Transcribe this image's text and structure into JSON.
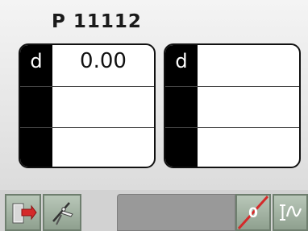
{
  "header": {
    "program_title": "P 11112"
  },
  "panels": [
    {
      "rows": [
        {
          "label": "d",
          "value": "0.00"
        },
        {
          "label": "",
          "value": ""
        },
        {
          "label": "",
          "value": ""
        }
      ]
    },
    {
      "rows": [
        {
          "label": "d",
          "value": ""
        },
        {
          "label": "",
          "value": ""
        },
        {
          "label": "",
          "value": ""
        }
      ]
    }
  ],
  "toolbar": {
    "exit_icon": "door-exit-icon",
    "tools_icon": "caliper-tools-icon",
    "status_text": "",
    "zero_label": "0",
    "curve_icon": "waveform-icon"
  },
  "colors": {
    "label_bg": "#000000",
    "panel_bg": "#ffffff",
    "button_green": "#9fb09f",
    "strike_red": "#d42a2a"
  }
}
